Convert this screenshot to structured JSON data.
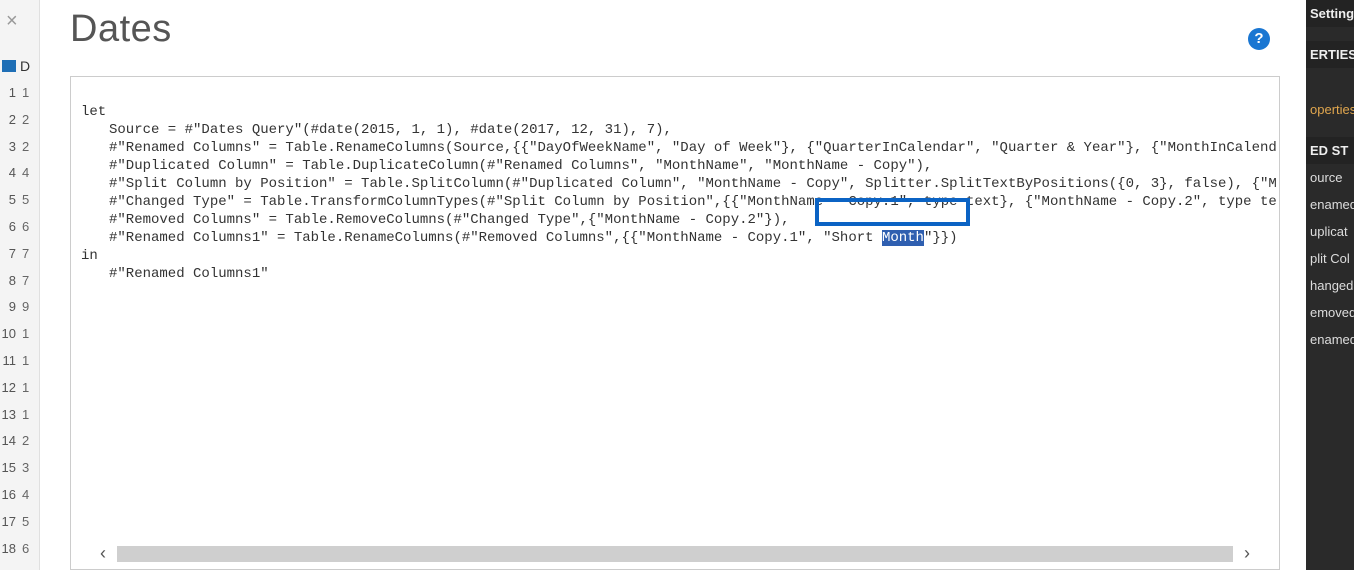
{
  "title": "Dates",
  "help_tooltip": "?",
  "close_label": "×",
  "table_glyph": "▦",
  "table_letter": "D",
  "row_numbers": [
    "1",
    "2",
    "3",
    "4",
    "5",
    "6",
    "7",
    "8",
    "9",
    "10",
    "11",
    "12",
    "13",
    "14",
    "15",
    "16",
    "17",
    "18"
  ],
  "row_data_fragments": [
    "1",
    "2",
    "2",
    "4",
    "5",
    "6",
    "7",
    "7",
    "9",
    "1",
    "1",
    "1",
    "1",
    "2",
    "3",
    "4",
    "5",
    "6"
  ],
  "code": {
    "l1": "let",
    "l2": "Source = #\"Dates Query\"(#date(2015, 1, 1), #date(2017, 12, 31), 7),",
    "l3": "#\"Renamed Columns\" = Table.RenameColumns(Source,{{\"DayOfWeekName\", \"Day of Week\"}, {\"QuarterInCalendar\", \"Quarter & Year\"}, {\"MonthInCalend",
    "l4": "#\"Duplicated Column\" = Table.DuplicateColumn(#\"Renamed Columns\", \"MonthName\", \"MonthName - Copy\"),",
    "l5": "#\"Split Column by Position\" = Table.SplitColumn(#\"Duplicated Column\", \"MonthName - Copy\", Splitter.SplitTextByPositions({0, 3}, false), {\"M",
    "l6": "#\"Changed Type\" = Table.TransformColumnTypes(#\"Split Column by Position\",{{\"MonthName - Copy.1\", type text}, {\"MonthName - Copy.2\", type te",
    "l7": "#\"Removed Columns\" = Table.RemoveColumns(#\"Changed Type\",{\"MonthName - Copy.2\"}),",
    "l8a": "#\"Renamed Columns1\" = Table.RenameColumns(#\"Removed Columns\",{{\"MonthName - Copy.1\", \"Short ",
    "l8b_sel": "Month",
    "l8c": "\"}})",
    "l9": "in",
    "l10": "#\"Renamed Columns1\""
  },
  "highlight_text": "\"Short Month\"}})",
  "scroll": {
    "left_glyph": "‹",
    "right_glyph": "›"
  },
  "right_panel": {
    "settings": "Settings",
    "properties": "ERTIES",
    "link": "operties",
    "applied_steps": "ED ST",
    "steps": [
      "ource",
      "enamed",
      "uplicat",
      "plit Col",
      "hanged",
      "emoved",
      "enamed"
    ]
  }
}
